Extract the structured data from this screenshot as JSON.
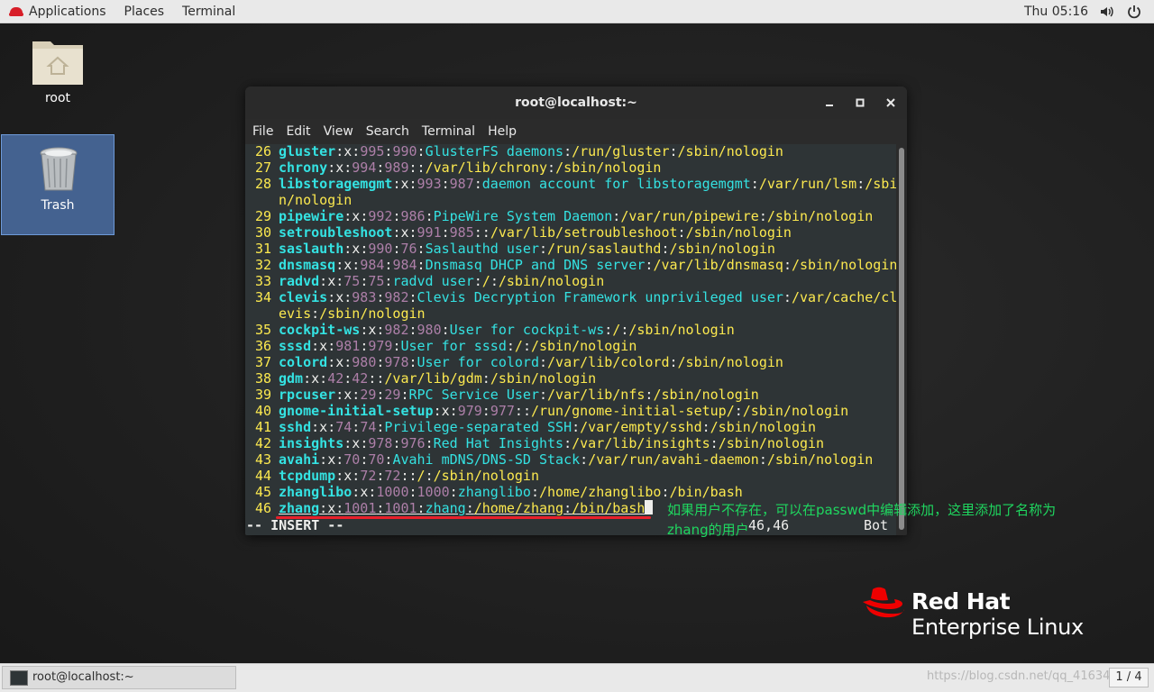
{
  "topbar": {
    "applications": "Applications",
    "places": "Places",
    "terminal": "Terminal",
    "clock": "Thu 05:16"
  },
  "desktop": {
    "root_label": "root",
    "trash_label": "Trash"
  },
  "window": {
    "title": "root@localhost:~",
    "menu": [
      "File",
      "Edit",
      "View",
      "Search",
      "Terminal",
      "Help"
    ]
  },
  "passwd_lines": [
    {
      "n": "26",
      "user": "gluster",
      "uid": "995",
      "gid": "990",
      "gecos": "GlusterFS daemons",
      "home": "/run/gluster",
      "shell": "/sbin/nologin"
    },
    {
      "n": "27",
      "user": "chrony",
      "uid": "994",
      "gid": "989",
      "gecos": "",
      "home": "/var/lib/chrony",
      "shell": "/sbin/nologin"
    },
    {
      "n": "28",
      "user": "libstoragemgmt",
      "uid": "993",
      "gid": "987",
      "gecos": "daemon account for libstoragemgmt",
      "home": "/var/run/lsm",
      "shell": "/sbi",
      "wrap": "n/nologin"
    },
    {
      "n": "29",
      "user": "pipewire",
      "uid": "992",
      "gid": "986",
      "gecos": "PipeWire System Daemon",
      "home": "/var/run/pipewire",
      "shell": "/sbin/nologin"
    },
    {
      "n": "30",
      "user": "setroubleshoot",
      "uid": "991",
      "gid": "985",
      "gecos": "",
      "home": "/var/lib/setroubleshoot",
      "shell": "/sbin/nologin"
    },
    {
      "n": "31",
      "user": "saslauth",
      "uid": "990",
      "gid": "76",
      "gecos": "Saslauthd user",
      "home": "/run/saslauthd",
      "shell": "/sbin/nologin"
    },
    {
      "n": "32",
      "user": "dnsmasq",
      "uid": "984",
      "gid": "984",
      "gecos": "Dnsmasq DHCP and DNS server",
      "home": "/var/lib/dnsmasq",
      "shell": "/sbin/nologin"
    },
    {
      "n": "33",
      "user": "radvd",
      "uid": "75",
      "gid": "75",
      "gecos": "radvd user",
      "home": "/",
      "shell": "/sbin/nologin"
    },
    {
      "n": "34",
      "user": "clevis",
      "uid": "983",
      "gid": "982",
      "gecos": "Clevis Decryption Framework unprivileged user",
      "home": "/var/cache/cl",
      "shell": "",
      "wrap": "evis:/sbin/nologin"
    },
    {
      "n": "35",
      "user": "cockpit-ws",
      "uid": "982",
      "gid": "980",
      "gecos": "User for cockpit-ws",
      "home": "/",
      "shell": "/sbin/nologin"
    },
    {
      "n": "36",
      "user": "sssd",
      "uid": "981",
      "gid": "979",
      "gecos": "User for sssd",
      "home": "/",
      "shell": "/sbin/nologin"
    },
    {
      "n": "37",
      "user": "colord",
      "uid": "980",
      "gid": "978",
      "gecos": "User for colord",
      "home": "/var/lib/colord",
      "shell": "/sbin/nologin"
    },
    {
      "n": "38",
      "user": "gdm",
      "uid": "42",
      "gid": "42",
      "gecos": "",
      "home": "/var/lib/gdm",
      "shell": "/sbin/nologin"
    },
    {
      "n": "39",
      "user": "rpcuser",
      "uid": "29",
      "gid": "29",
      "gecos": "RPC Service User",
      "home": "/var/lib/nfs",
      "shell": "/sbin/nologin"
    },
    {
      "n": "40",
      "user": "gnome-initial-setup",
      "uid": "979",
      "gid": "977",
      "gecos": "",
      "home": "/run/gnome-initial-setup/",
      "shell": "/sbin/nologin"
    },
    {
      "n": "41",
      "user": "sshd",
      "uid": "74",
      "gid": "74",
      "gecos": "Privilege-separated SSH",
      "home": "/var/empty/sshd",
      "shell": "/sbin/nologin"
    },
    {
      "n": "42",
      "user": "insights",
      "uid": "978",
      "gid": "976",
      "gecos": "Red Hat Insights",
      "home": "/var/lib/insights",
      "shell": "/sbin/nologin"
    },
    {
      "n": "43",
      "user": "avahi",
      "uid": "70",
      "gid": "70",
      "gecos": "Avahi mDNS/DNS-SD Stack",
      "home": "/var/run/avahi-daemon",
      "shell": "/sbin/nologin"
    },
    {
      "n": "44",
      "user": "tcpdump",
      "uid": "72",
      "gid": "72",
      "gecos": "",
      "home": "/",
      "shell": "/sbin/nologin"
    },
    {
      "n": "45",
      "user": "zhanglibo",
      "uid": "1000",
      "gid": "1000",
      "gecos": "zhanglibo",
      "home": "/home/zhanglibo",
      "shell": "/bin/bash"
    },
    {
      "n": "46",
      "user": "zhang",
      "uid": "1001",
      "gid": "1001",
      "gecos": "zhang",
      "home": "/home/zhang",
      "shell": "/bin/bash"
    }
  ],
  "status": {
    "mode": "-- INSERT --",
    "position": "46,46",
    "scroll": "Bot"
  },
  "annotation": "如果用户不存在，可以在passwd中编辑添加，这里添加了名称为zhang的用户",
  "logo": {
    "line1": "Red Hat",
    "line2": "Enterprise Linux"
  },
  "taskbar": {
    "task_label": "root@localhost:~",
    "watermark": "https://blog.csdn.net/qq_41634",
    "pager": "1 / 4"
  },
  "colors": {
    "accent_red": "#e8202a",
    "annotation_green": "#1fd65f",
    "term_bg": "#2e3436"
  }
}
